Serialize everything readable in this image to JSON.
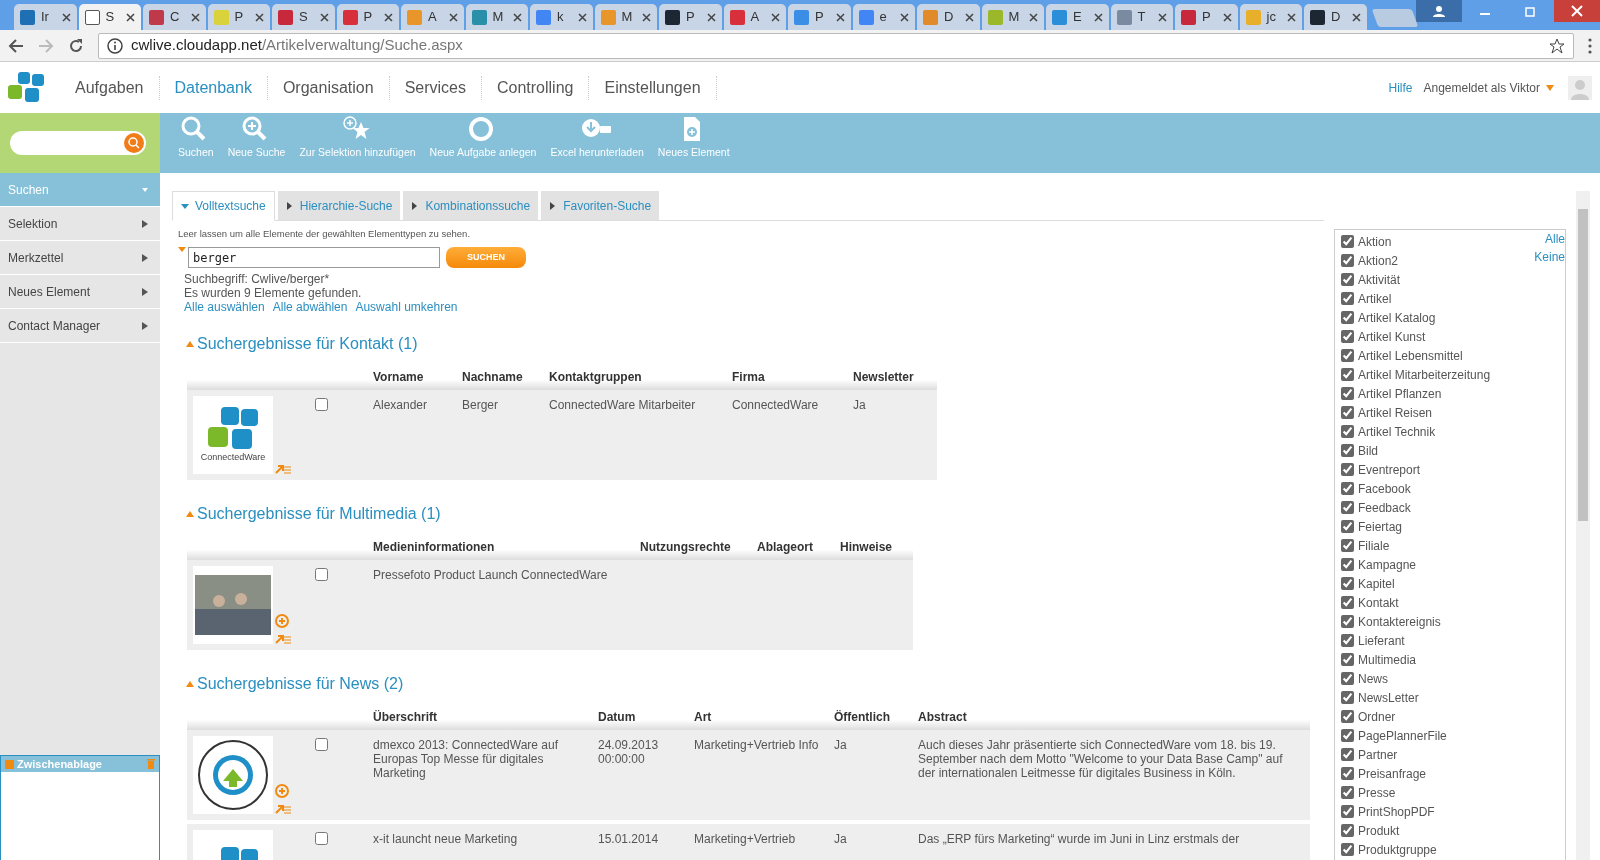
{
  "browser": {
    "tabs": [
      {
        "title": "Ir",
        "selected": false,
        "color": "#1f6fb5"
      },
      {
        "title": "S",
        "selected": true,
        "color": "#ffffff"
      },
      {
        "title": "C",
        "selected": false,
        "color": "#c0394b"
      },
      {
        "title": "P",
        "selected": false,
        "color": "#d9d23a"
      },
      {
        "title": "S",
        "selected": false,
        "color": "#c8283c"
      },
      {
        "title": "P",
        "selected": false,
        "color": "#d8303a"
      },
      {
        "title": "A",
        "selected": false,
        "color": "#e8952a"
      },
      {
        "title": "M",
        "selected": false,
        "color": "#2a8fa8"
      },
      {
        "title": "k",
        "selected": false,
        "color": "#4285f4"
      },
      {
        "title": "M",
        "selected": false,
        "color": "#e8952a"
      },
      {
        "title": "P",
        "selected": false,
        "color": "#1d2733"
      },
      {
        "title": "A",
        "selected": false,
        "color": "#d8303a"
      },
      {
        "title": "P",
        "selected": false,
        "color": "#3a8ee6"
      },
      {
        "title": "e",
        "selected": false,
        "color": "#4285f4"
      },
      {
        "title": "D",
        "selected": false,
        "color": "#e08a2a"
      },
      {
        "title": "M",
        "selected": false,
        "color": "#9ab82a"
      },
      {
        "title": "E",
        "selected": false,
        "color": "#2a8fd8"
      },
      {
        "title": "T",
        "selected": false,
        "color": "#7a8aa0"
      },
      {
        "title": "P",
        "selected": false,
        "color": "#c8283c"
      },
      {
        "title": "jc",
        "selected": false,
        "color": "#e8b02a"
      },
      {
        "title": "D",
        "selected": false,
        "color": "#1d2733"
      }
    ],
    "address": {
      "host": "cwlive.cloudapp.net",
      "path": "/Artikelverwaltung/Suche.aspx"
    }
  },
  "nav": {
    "items": [
      {
        "label": "Aufgaben",
        "selected": false
      },
      {
        "label": "Datenbank",
        "selected": true
      },
      {
        "label": "Organisation",
        "selected": false
      },
      {
        "label": "Services",
        "selected": false
      },
      {
        "label": "Controlling",
        "selected": false
      },
      {
        "label": "Einstellungen",
        "selected": false
      }
    ],
    "help": "Hilfe",
    "user": "Angemeldet als Viktor"
  },
  "toolbar": [
    "Suchen",
    "Neue Suche",
    "Zur Selektion hinzufügen",
    "Neue Aufgabe anlegen",
    "Excel herunterladen",
    "Neues Element"
  ],
  "sidebar": {
    "items": [
      {
        "label": "Suchen",
        "selected": true
      },
      {
        "label": "Selektion",
        "selected": false
      },
      {
        "label": "Merkzettel",
        "selected": false
      },
      {
        "label": "Neues Element",
        "selected": false
      },
      {
        "label": "Contact Manager",
        "selected": false
      }
    ],
    "clipboard": "Zwischenablage"
  },
  "search": {
    "tabs": [
      {
        "label": "Volltextsuche",
        "selected": true
      },
      {
        "label": "Hierarchie-Suche",
        "selected": false
      },
      {
        "label": "Kombinationssuche",
        "selected": false
      },
      {
        "label": "Favoriten-Suche",
        "selected": false
      }
    ],
    "hint": "Leer lassen um alle Elemente der gewählten Elementtypen zu sehen.",
    "query": "berger",
    "button": "SUCHEN",
    "term": "Suchbegriff: Cwlive/berger*",
    "found": "Es wurden 9 Elemente gefunden.",
    "links": [
      "Alle auswählen",
      "Alle abwählen",
      "Auswahl umkehren"
    ]
  },
  "results": [
    {
      "title": "Suchergebnisse für Kontakt (1)",
      "columns": [
        "Vorname",
        "Nachname",
        "Kontaktgruppen",
        "Firma",
        "Newsletter"
      ],
      "rows": [
        {
          "kind": "logo",
          "caption": "ConnectedWare",
          "checked": false,
          "can_add": false,
          "cells": [
            "Alexander",
            "Berger",
            "ConnectedWare Mitarbeiter",
            "ConnectedWare",
            "Ja"
          ]
        }
      ]
    },
    {
      "title": "Suchergebnisse für Multimedia (1)",
      "columns": [
        "Medieninformationen",
        "Nutzungsrechte",
        "Ablageort",
        "Hinweise"
      ],
      "rows": [
        {
          "kind": "photo",
          "checked": false,
          "can_add": true,
          "cells": [
            "Pressefoto Product Launch ConnectedWare",
            "",
            "",
            ""
          ]
        }
      ]
    },
    {
      "title": "Suchergebnisse für News (2)",
      "columns": [
        "Überschrift",
        "Datum",
        "Art",
        "Öffentlich",
        "Abstract"
      ],
      "rows": [
        {
          "kind": "badge",
          "checked": false,
          "can_add": true,
          "cells": [
            "dmexco 2013: ConnectedWare auf Europas Top Messe für digitales Marketing",
            "24.09.2013 00:00:00",
            "Marketing+Vertrieb Info",
            "Ja",
            "Auch dieses Jahr präsentierte sich ConnectedWare vom 18. bis 19. September nach dem Motto \"Welcome to your Data Base Camp\" auf der internationalen Leitmesse für digitales Business in Köln."
          ]
        },
        {
          "kind": "logo-cut",
          "checked": false,
          "cells": [
            "x-it launcht neue Marketing",
            "15.01.2014",
            "Marketing+Vertrieb",
            "Ja",
            "Das „ERP fürs Marketing“ wurde im Juni in Linz erstmals der"
          ]
        }
      ]
    }
  ],
  "types": {
    "all": "Alle",
    "none": "Keine",
    "items": [
      {
        "label": "Aktion",
        "checked": true
      },
      {
        "label": "Aktion2",
        "checked": true
      },
      {
        "label": "Aktivität",
        "checked": true
      },
      {
        "label": "Artikel",
        "checked": true
      },
      {
        "label": "Artikel Katalog",
        "checked": true
      },
      {
        "label": "Artikel Kunst",
        "checked": true
      },
      {
        "label": "Artikel Lebensmittel",
        "checked": true
      },
      {
        "label": "Artikel Mitarbeiterzeitung",
        "checked": true
      },
      {
        "label": "Artikel Pflanzen",
        "checked": true
      },
      {
        "label": "Artikel Reisen",
        "checked": true
      },
      {
        "label": "Artikel Technik",
        "checked": true
      },
      {
        "label": "Bild",
        "checked": true
      },
      {
        "label": "Eventreport",
        "checked": true
      },
      {
        "label": "Facebook",
        "checked": true
      },
      {
        "label": "Feedback",
        "checked": true
      },
      {
        "label": "Feiertag",
        "checked": true
      },
      {
        "label": "Filiale",
        "checked": true
      },
      {
        "label": "Kampagne",
        "checked": true
      },
      {
        "label": "Kapitel",
        "checked": true
      },
      {
        "label": "Kontakt",
        "checked": true
      },
      {
        "label": "Kontaktereignis",
        "checked": true
      },
      {
        "label": "Lieferant",
        "checked": true
      },
      {
        "label": "Multimedia",
        "checked": true
      },
      {
        "label": "News",
        "checked": true
      },
      {
        "label": "NewsLetter",
        "checked": true
      },
      {
        "label": "Ordner",
        "checked": true
      },
      {
        "label": "PagePlannerFile",
        "checked": true
      },
      {
        "label": "Partner",
        "checked": true
      },
      {
        "label": "Preisanfrage",
        "checked": true
      },
      {
        "label": "Presse",
        "checked": true
      },
      {
        "label": "PrintShopPDF",
        "checked": true
      },
      {
        "label": "Produkt",
        "checked": true
      },
      {
        "label": "Produktgruppe",
        "checked": true
      }
    ]
  }
}
